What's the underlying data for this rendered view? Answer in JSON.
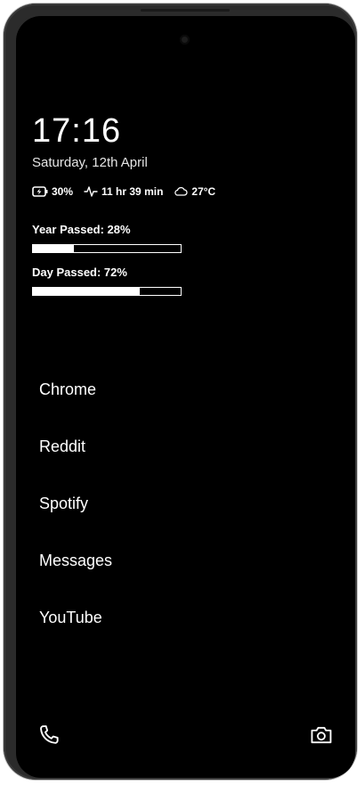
{
  "clock": {
    "time": "17:16",
    "date": "Saturday, 12th April"
  },
  "status": {
    "battery": {
      "icon": "battery-charging-icon",
      "value": "30%"
    },
    "screen_time": {
      "icon": "activity-icon",
      "value": "11 hr 39 min"
    },
    "weather": {
      "icon": "cloud-icon",
      "value": "27°C"
    }
  },
  "progress": {
    "year": {
      "label": "Year Passed: 28%",
      "fraction": 0.28
    },
    "day": {
      "label": "Day Passed: 72%",
      "fraction": 0.72
    }
  },
  "apps": [
    {
      "label": "Chrome"
    },
    {
      "label": "Reddit"
    },
    {
      "label": "Spotify"
    },
    {
      "label": "Messages"
    },
    {
      "label": "YouTube"
    }
  ],
  "dock": {
    "left_icon": "phone-icon",
    "right_icon": "camera-icon"
  },
  "colors": {
    "background": "#000000",
    "foreground": "#ffffff",
    "frame": "#2b2b2b"
  }
}
